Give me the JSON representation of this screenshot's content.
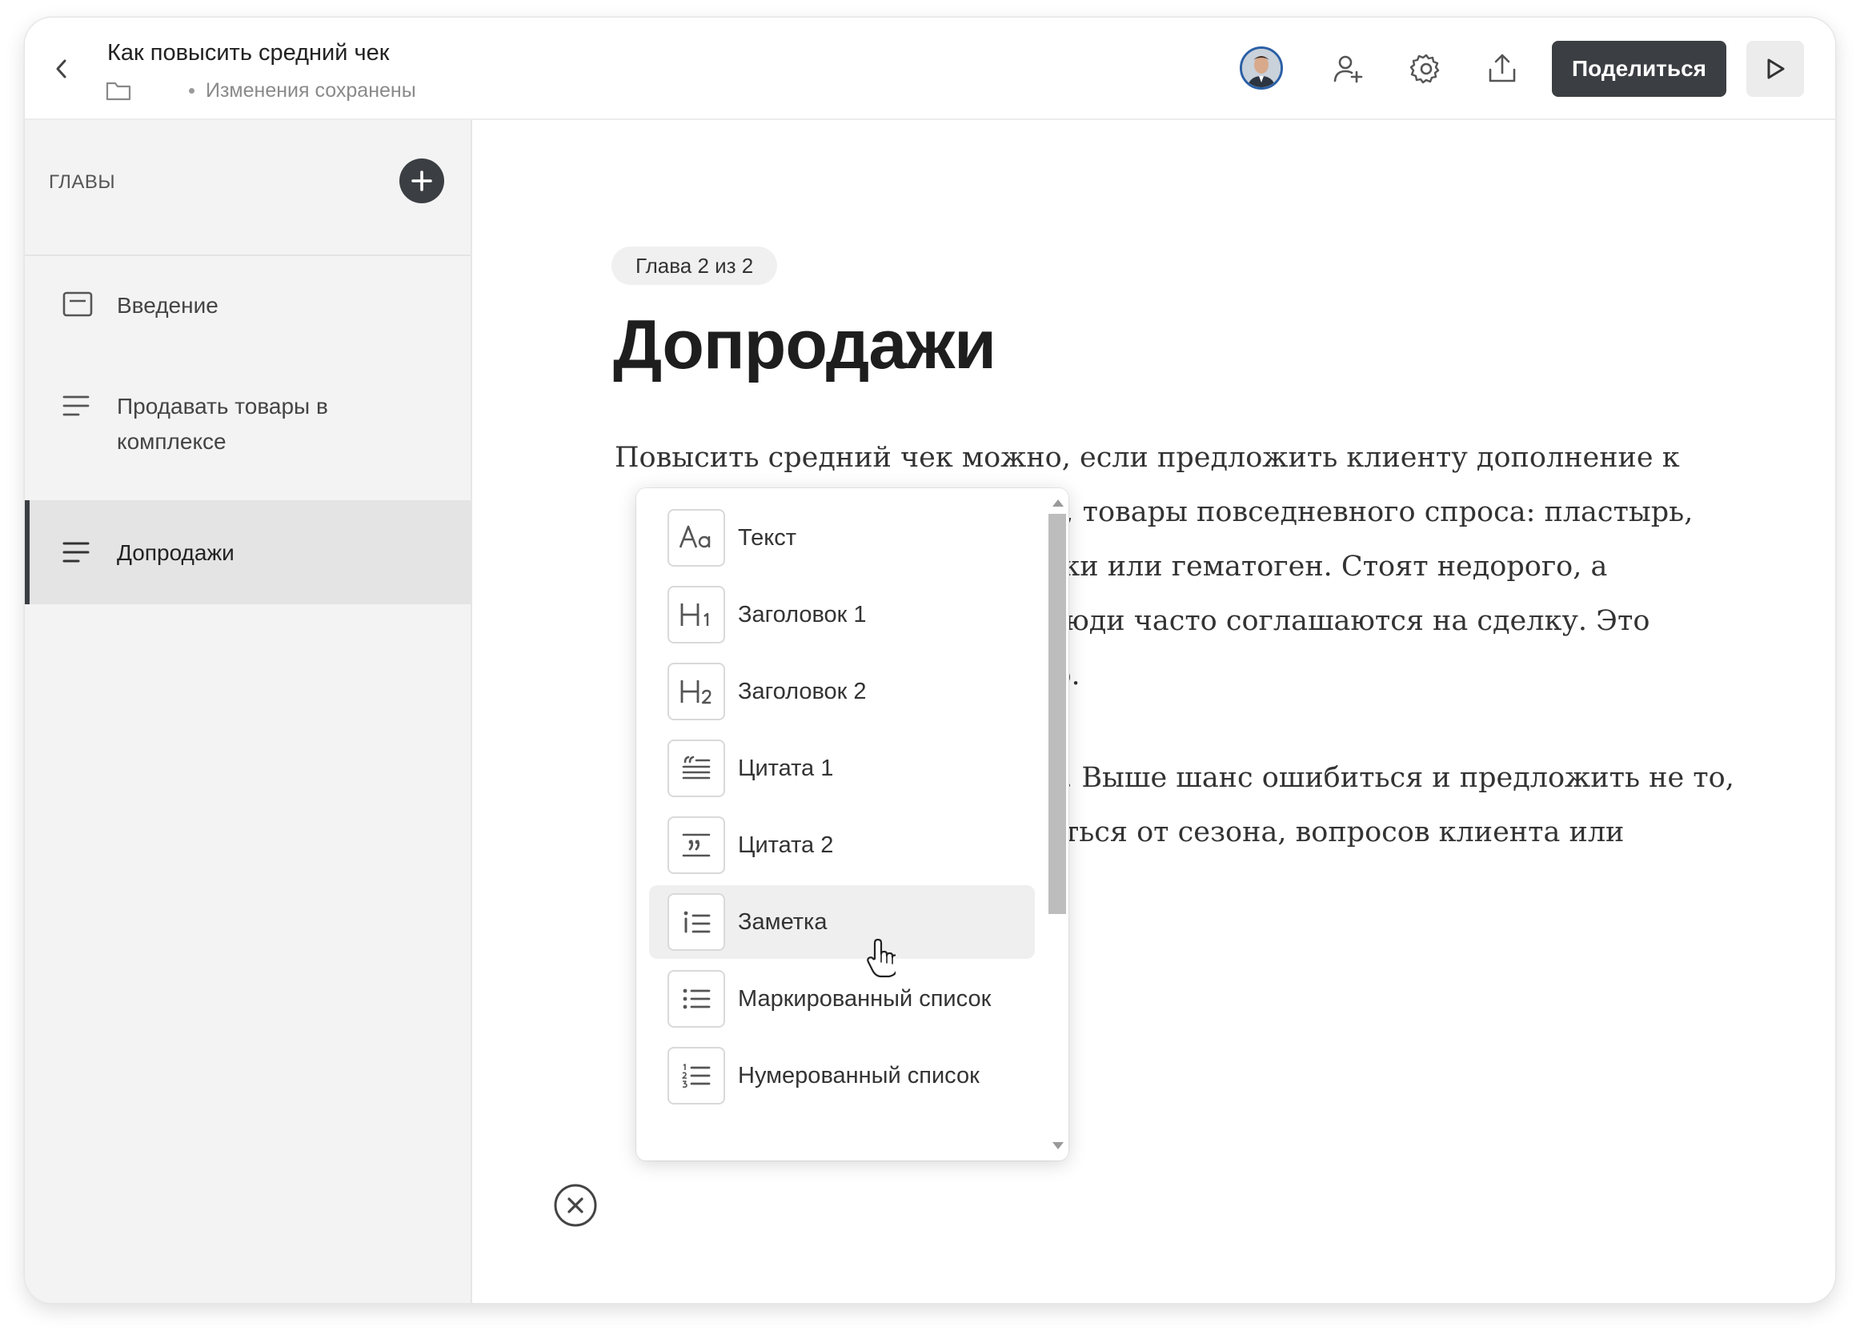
{
  "header": {
    "title": "Как повысить средний чек",
    "status": "Изменения сохранены",
    "share_label": "Поделиться"
  },
  "sidebar": {
    "heading": "ГЛАВЫ",
    "items": [
      {
        "label_lines": [
          "Введение"
        ],
        "icon": "chapter-cover-icon",
        "active": false
      },
      {
        "label_lines": [
          "Продавать товары в",
          "комплексе"
        ],
        "icon": "text-lines-icon",
        "active": false
      },
      {
        "label_lines": [
          "Допродажи"
        ],
        "icon": "text-lines-icon",
        "active": true
      }
    ]
  },
  "main": {
    "chapter_badge": "Глава 2 из 2",
    "chapter_title": "Допродажи",
    "paragraph1": [
      "Повысить средний чек можно, если предложить клиенту дополнение к",
      "р, товары повседневного спроса: пластырь,",
      "тки или гематоген. Стоят недорого, а",
      "люди часто соглашаются на сделку. Это",
      "ю."
    ],
    "paragraph2": [
      "о. Выше шанс ошибиться и предложить не то,",
      "аться от сезона, вопросов клиента или"
    ]
  },
  "dropdown": {
    "items": [
      {
        "label": "Текст",
        "icon": "text-style-icon"
      },
      {
        "label": "Заголовок 1",
        "icon": "heading-1-icon"
      },
      {
        "label": "Заголовок 2",
        "icon": "heading-2-icon"
      },
      {
        "label": "Цитата 1",
        "icon": "quote-1-icon"
      },
      {
        "label": "Цитата 2",
        "icon": "quote-2-icon"
      },
      {
        "label": "Заметка",
        "icon": "note-icon",
        "hovered": true
      },
      {
        "label": "Маркированный список",
        "icon": "bulleted-list-icon"
      },
      {
        "label": "Нумерованный список",
        "icon": "numbered-list-icon"
      }
    ]
  },
  "colors": {
    "accent_dark": "#3b3e42",
    "sidebar_bg": "#f3f3f3",
    "active_item_bg": "#e4e4e4"
  }
}
